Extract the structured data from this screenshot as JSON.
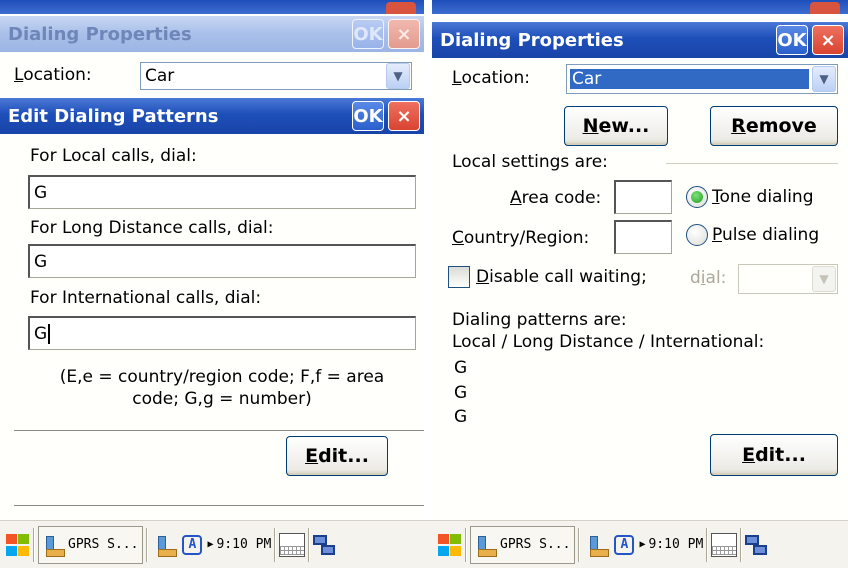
{
  "left": {
    "back_dialog": {
      "title": "Dialing Properties",
      "ok": "OK",
      "close": "×",
      "location_label": "Location:",
      "location_underline": "L",
      "location_rest": "ocation:",
      "location_value": "Car"
    },
    "dialog": {
      "title": "Edit Dialing Patterns",
      "ok": "OK",
      "close": "×",
      "local_label": "For Local calls, dial:",
      "local_value": "G",
      "long_label": "For Long Distance calls, dial:",
      "long_value": "G",
      "intl_label": "For International calls, dial:",
      "intl_value": "G",
      "help_line1": "(E,e = country/region code; F,f = area",
      "help_line2": "code; G,g = number)",
      "edit_button_u": "E",
      "edit_button_rest": "dit..."
    }
  },
  "right": {
    "dialog": {
      "title": "Dialing Properties",
      "ok": "OK",
      "close": "×",
      "location_label_u": "L",
      "location_label_rest": "ocation:",
      "location_value": "Car",
      "new_button_u": "N",
      "new_button_rest": "ew...",
      "remove_button_u": "R",
      "remove_button_rest": "emove",
      "local_settings": "Local settings are:",
      "area_code_u": "A",
      "area_code_rest": "rea code:",
      "area_code_value": "",
      "country_u": "C",
      "country_rest": "ountry/Region:",
      "country_value": "",
      "tone_u": "T",
      "tone_rest": "one dialing",
      "pulse_u": "P",
      "pulse_rest": "ulse dialing",
      "disable_u": "D",
      "disable_rest": "isable call waiting;",
      "dial_label_a": "d",
      "dial_label_u": "i",
      "dial_label_b": "al:",
      "patterns_label": "Dialing patterns are:",
      "patterns_header": "Local / Long Distance / International:",
      "pattern_local": "G",
      "pattern_long": "G",
      "pattern_intl": "G",
      "edit_button_u": "E",
      "edit_button_rest": "dit..."
    }
  },
  "taskbar": {
    "app_label": "GPRS S...",
    "ime_label": "A",
    "time": "9:10 PM"
  },
  "icons": {
    "start": "windows-flag-icon",
    "app": "gprs-app-icon",
    "keyboard": "keyboard-icon",
    "desktop": "switch-windows-icon"
  }
}
